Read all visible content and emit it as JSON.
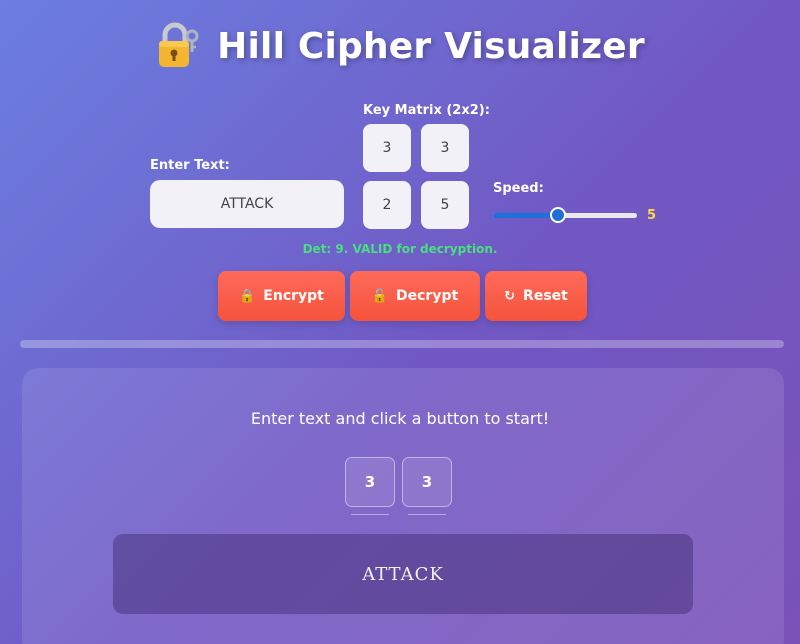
{
  "header": {
    "title": "Hill Cipher Visualizer",
    "icon": "lock-with-key-icon"
  },
  "controls": {
    "text_label": "Enter Text:",
    "text_value": "ATTACK",
    "matrix_label": "Key Matrix (2x2):",
    "matrix": [
      "3",
      "3",
      "2",
      "5"
    ],
    "speed_label": "Speed:",
    "speed_value": "5",
    "speed_fraction": 0.45,
    "determinant_msg": "Det: 9. VALID for decryption.",
    "determinant_color": "#4ade80"
  },
  "buttons": {
    "encrypt": {
      "icon": "🔒",
      "label": "Encrypt"
    },
    "decrypt": {
      "icon": "🔓",
      "label": "Decrypt"
    },
    "reset": {
      "icon": "↻",
      "label": "Reset"
    }
  },
  "visualizer": {
    "status": "Enter text and click a button to start!",
    "matrix_row1": [
      "3",
      "3"
    ],
    "output_text": "ATTACK"
  },
  "colors": {
    "button": "#f5533b",
    "accent": "#1e6fd6",
    "speed_value": "#ffd84a"
  }
}
